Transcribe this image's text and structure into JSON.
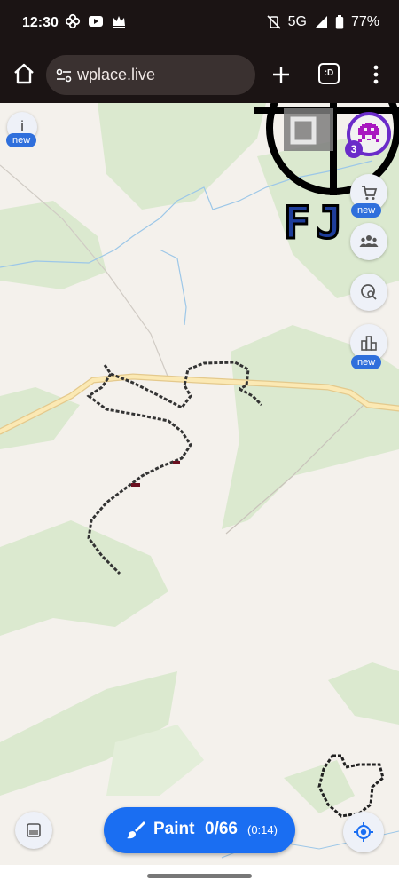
{
  "status_bar": {
    "time": "12:30",
    "network": "5G",
    "battery": "77%",
    "icons_left": [
      "pinwheel-icon",
      "youtube-icon",
      "crown-icon"
    ],
    "icons_right": [
      "vibrate-off-icon",
      "signal-icon",
      "battery-icon"
    ]
  },
  "browser": {
    "url": "wplace.live",
    "tabs_label": ":D"
  },
  "map": {
    "info_label": "i",
    "new_badge": "new",
    "notification_count": "3",
    "pixel_art_text": "FJ",
    "buttons": [
      "store-icon",
      "leaderboard-group-icon",
      "search-map-icon",
      "ranking-chart-icon",
      "palette-icon",
      "my-location-icon"
    ]
  },
  "paint": {
    "label": "Paint",
    "count": "0/66",
    "timer": "(0:14)"
  },
  "colors": {
    "accent": "#1a6ef2",
    "badge": "#2f6fdc",
    "avatar_ring": "#6a2bc9",
    "status_bg": "#1b1414"
  }
}
